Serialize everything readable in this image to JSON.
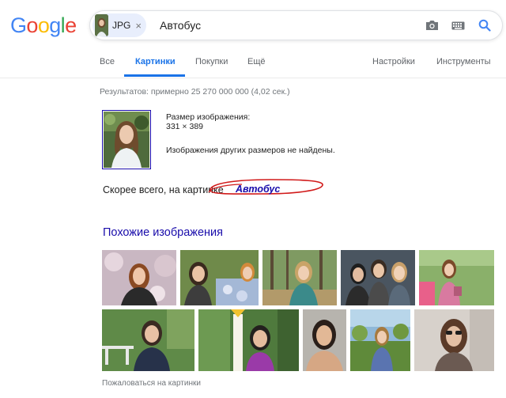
{
  "logo": {
    "letters": [
      "G",
      "o",
      "o",
      "g",
      "l",
      "e"
    ],
    "colors": [
      "#4285f4",
      "#ea4335",
      "#fbbc05",
      "#4285f4",
      "#34a853",
      "#ea4335"
    ]
  },
  "search": {
    "chip_label": "JPG",
    "chip_close": "×",
    "query": "Автобус"
  },
  "icons": {
    "camera": "camera-icon",
    "keyboard": "keyboard-icon",
    "search": "search-icon"
  },
  "tabs": {
    "all": "Все",
    "images": "Картинки",
    "shopping": "Покупки",
    "more": "Ещё",
    "settings": "Настройки",
    "tools": "Инструменты"
  },
  "results": {
    "stats": "Результатов: примерно 25 270 000 000 (4,02 сек.)",
    "size_label": "Размер изображения:",
    "size_value": "331 × 389",
    "no_other_sizes": "Изображения других размеров не найдены.",
    "best_guess_prefix": "Скорее всего, на картинке",
    "best_guess_link": "Автобус"
  },
  "similar": {
    "title": "Похожие изображения",
    "report": "Пожаловаться на картинки"
  },
  "colors": {
    "accent": "#1a73e8",
    "link": "#1a0dab",
    "annotation": "#d11a1a"
  }
}
